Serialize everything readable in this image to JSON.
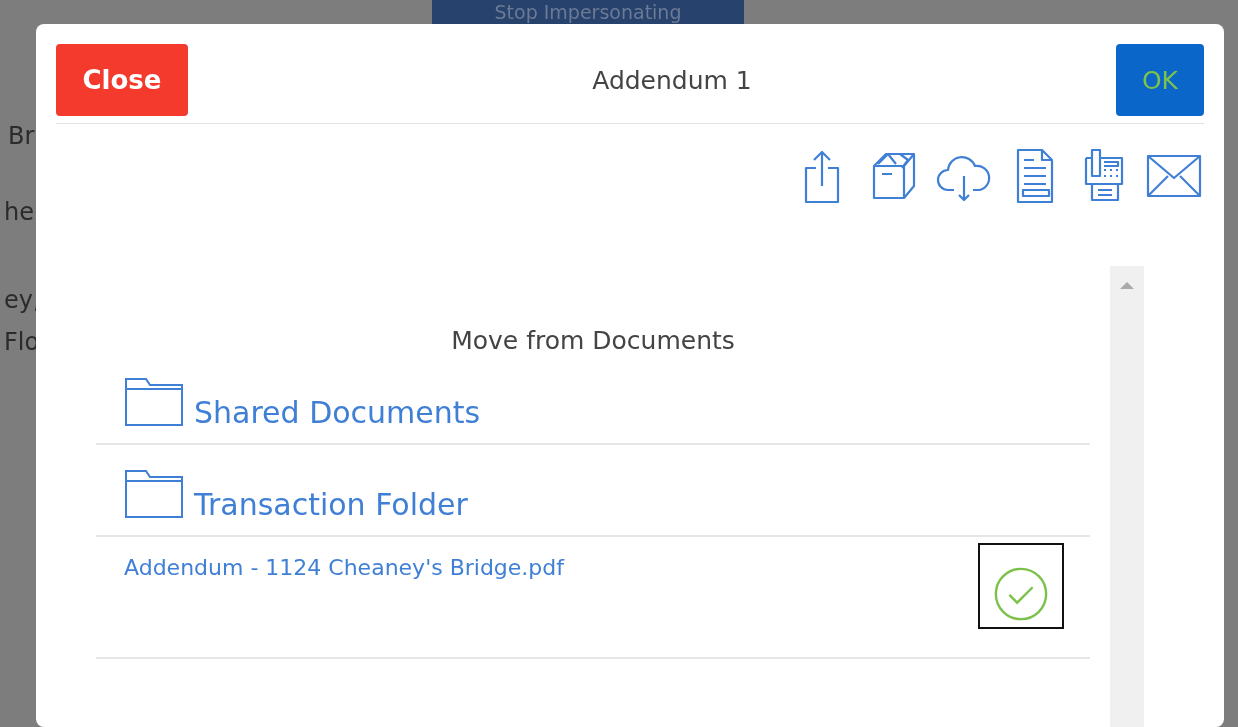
{
  "background": {
    "button": "Stop Impersonating",
    "fragments": [
      "Br",
      "he",
      "ey,",
      "Flo"
    ]
  },
  "dialog": {
    "title": "Addendum 1",
    "close_button": "Close",
    "ok_button": "OK",
    "toolbar": [
      {
        "kind": "share"
      },
      {
        "kind": "box"
      },
      {
        "kind": "cloud"
      },
      {
        "kind": "document"
      },
      {
        "kind": "fax"
      },
      {
        "kind": "mail"
      }
    ],
    "heading": "Move from Documents",
    "folders": [
      {
        "name": "Shared Documents"
      },
      {
        "name": "Transaction Folder"
      }
    ],
    "files": [
      {
        "name": "Addendum - 1124 Cheaney's Bridge.pdf",
        "checked": true
      }
    ]
  }
}
